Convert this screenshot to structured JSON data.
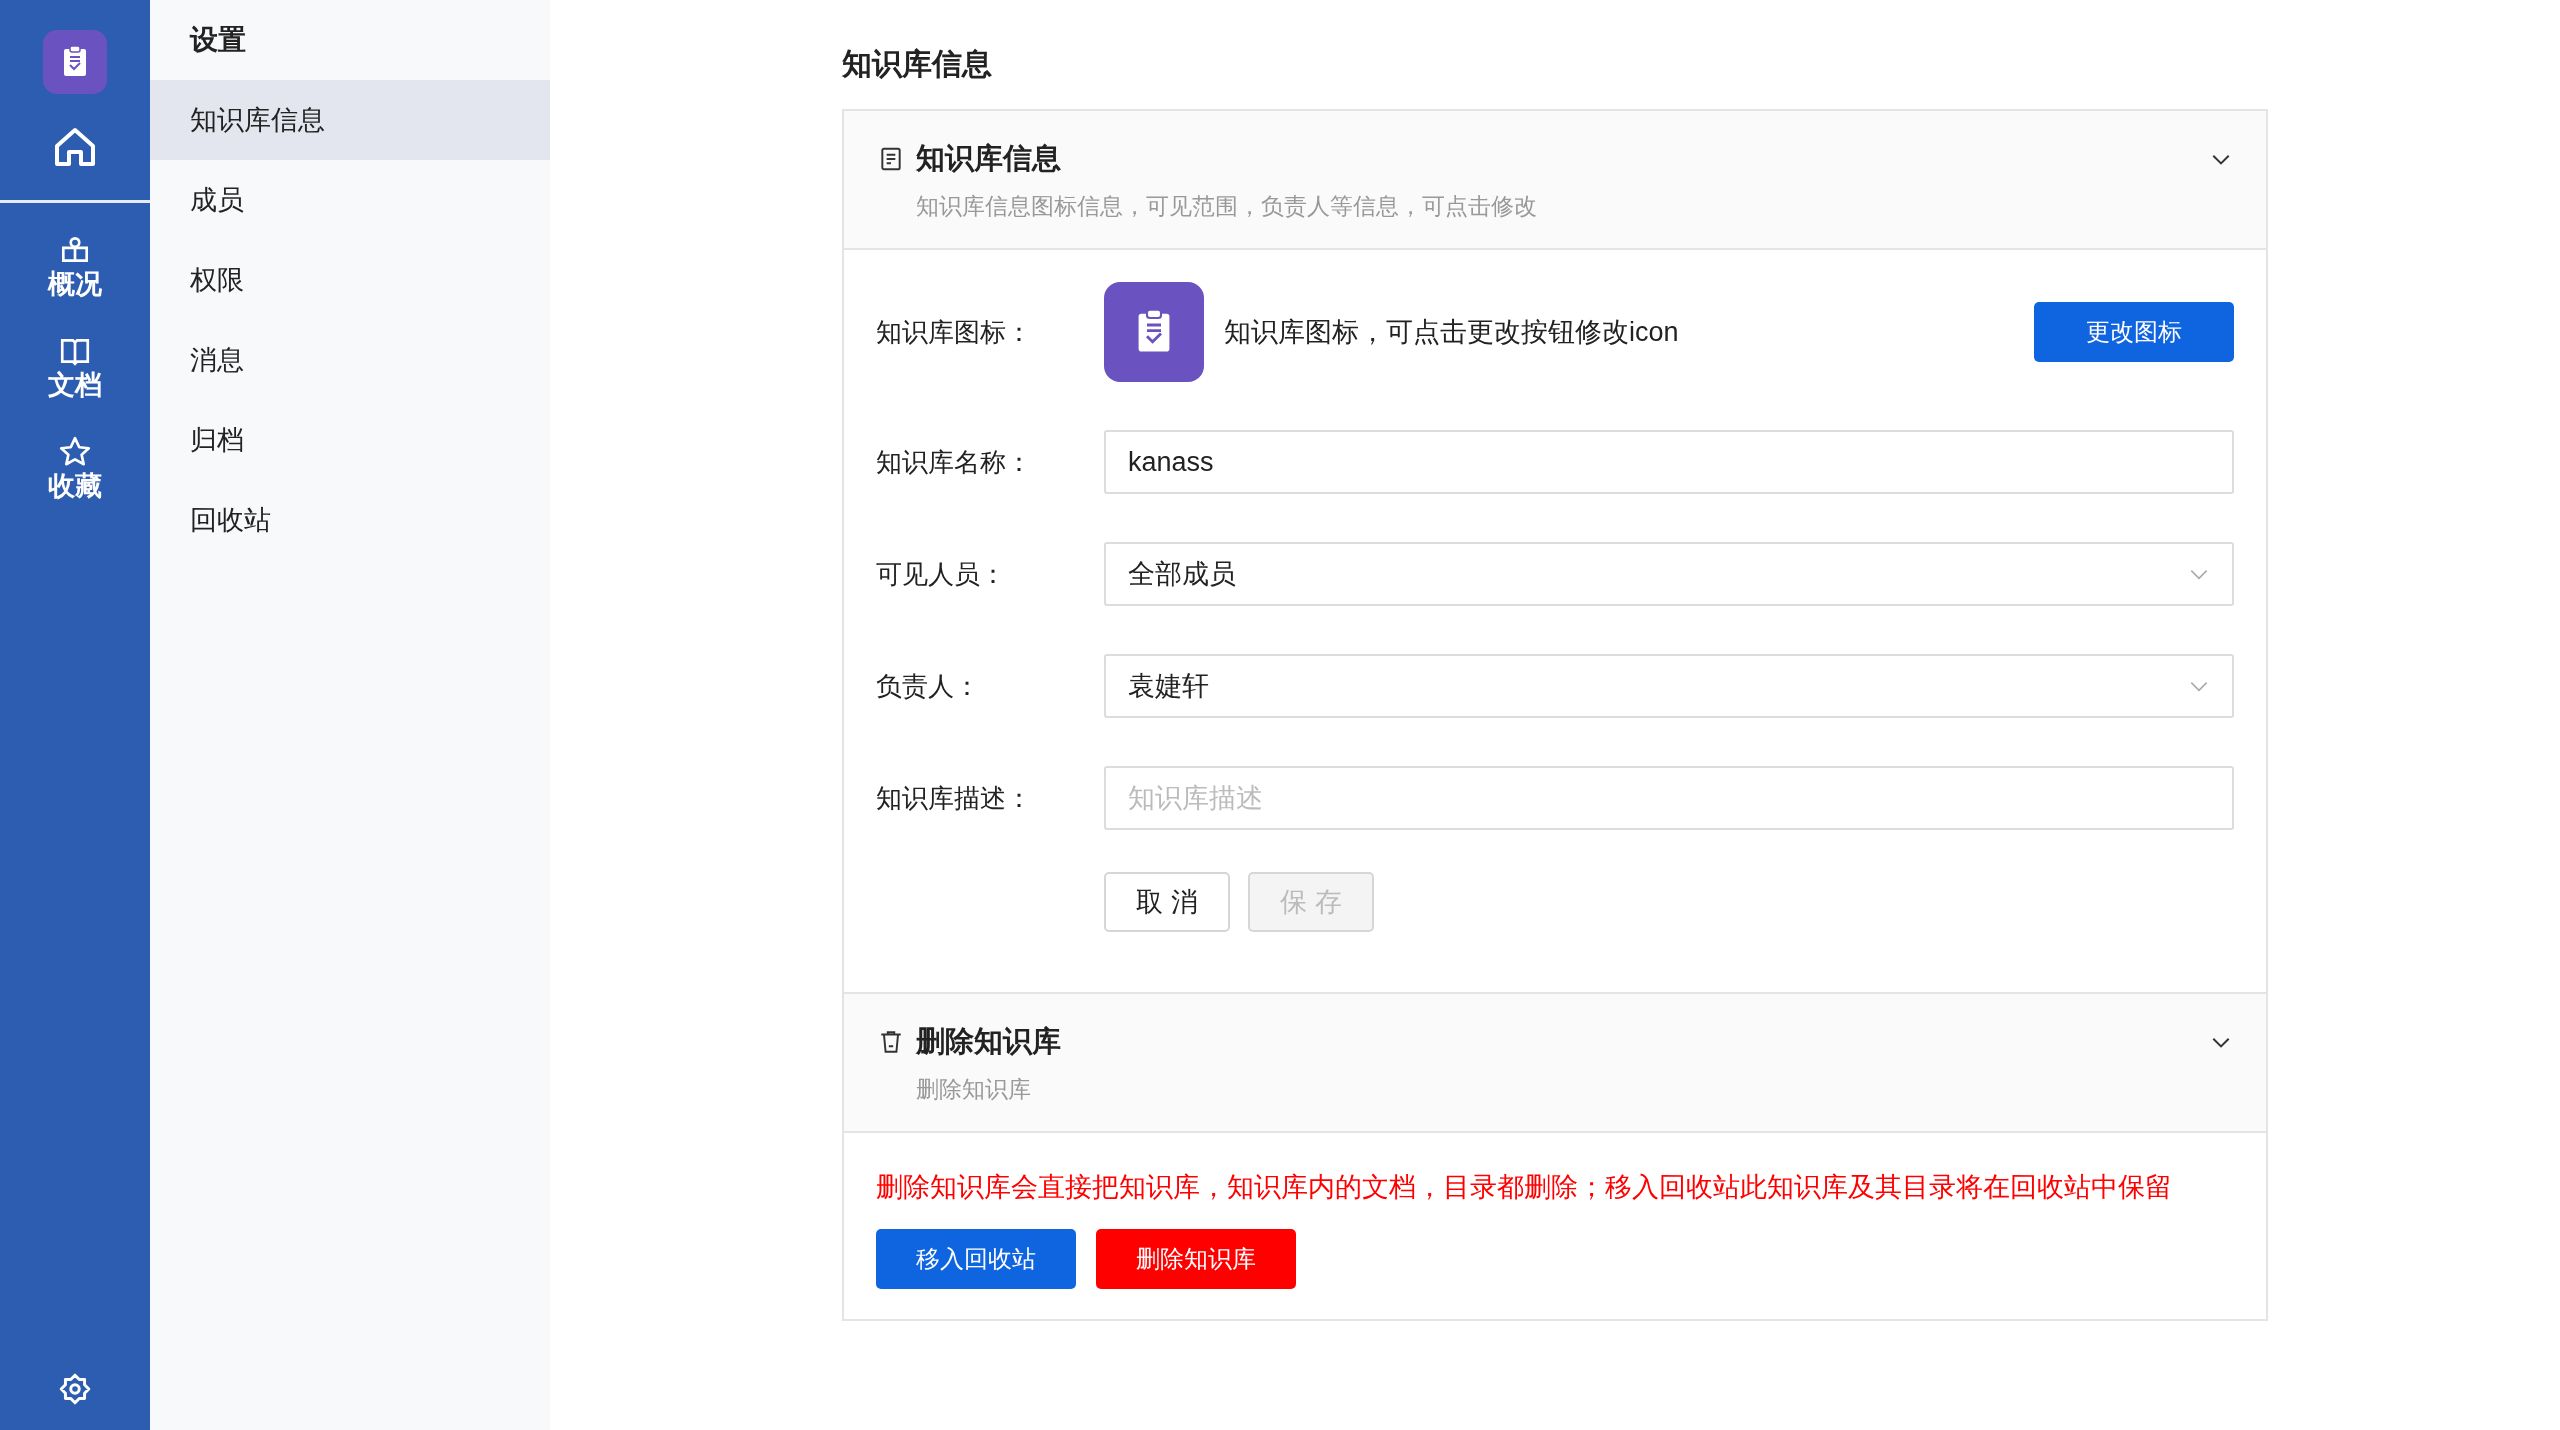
{
  "rail": {
    "items": [
      {
        "kind": "home"
      },
      {
        "kind": "overview",
        "label": "概况"
      },
      {
        "kind": "docs",
        "label": "文档"
      },
      {
        "kind": "favorites",
        "label": "收藏"
      }
    ]
  },
  "sidebar": {
    "title": "设置",
    "items": [
      {
        "label": "知识库信息",
        "selected": true
      },
      {
        "label": "成员",
        "selected": false
      },
      {
        "label": "权限",
        "selected": false
      },
      {
        "label": "消息",
        "selected": false
      },
      {
        "label": "归档",
        "selected": false
      },
      {
        "label": "回收站",
        "selected": false
      }
    ]
  },
  "page_title": "知识库信息",
  "info_section": {
    "title": "知识库信息",
    "subtitle": "知识库信息图标信息，可见范围，负责人等信息，可点击修改",
    "icon_row": {
      "label": "知识库图标：",
      "hint": "知识库图标，可点击更改按钮修改icon",
      "button": "更改图标"
    },
    "fields": [
      {
        "kind": "input",
        "label": "知识库名称：",
        "value": "kanass"
      },
      {
        "kind": "select",
        "label": "可见人员：",
        "value": "全部成员"
      },
      {
        "kind": "select",
        "label": "负责人：",
        "value": "袁婕轩"
      },
      {
        "kind": "input",
        "label": "知识库描述：",
        "placeholder": "知识库描述"
      }
    ],
    "actions": [
      {
        "label": "取 消",
        "disabled": false
      },
      {
        "label": "保 存",
        "disabled": true
      }
    ]
  },
  "delete_section": {
    "title": "删除知识库",
    "subtitle": "删除知识库",
    "warning": "删除知识库会直接把知识库，知识库内的文档，目录都删除；移入回收站此知识库及其目录将在回收站中保留",
    "buttons": [
      {
        "kind": "primary",
        "label": "移入回收站"
      },
      {
        "kind": "danger",
        "label": "删除知识库"
      }
    ]
  }
}
